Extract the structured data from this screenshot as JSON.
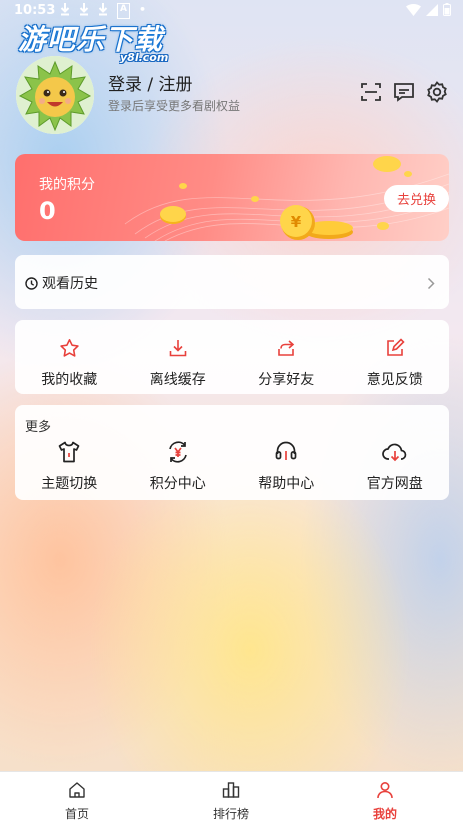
{
  "status_bar": {
    "time": "10:53",
    "left_icons": [
      "download-icon",
      "download-icon",
      "download-icon",
      "A",
      "•"
    ],
    "right_icons": [
      "wifi-icon",
      "signal-icon",
      "battery-icon"
    ]
  },
  "watermark": {
    "text_cn": "游吧乐下载",
    "text_en": "y8l.com"
  },
  "profile": {
    "avatar_icon": "durian-mascot-icon",
    "title": "登录 / 注册",
    "subtitle": "登录后享受更多看剧权益"
  },
  "top_actions": [
    "scan-icon",
    "message-icon",
    "settings-icon"
  ],
  "points": {
    "title": "我的积分",
    "value": "0",
    "redeem_label": "去兑换"
  },
  "history": {
    "label": "观看历史"
  },
  "quick_actions": [
    {
      "label": "我的收藏",
      "icon": "star-icon"
    },
    {
      "label": "离线缓存",
      "icon": "download-icon"
    },
    {
      "label": "分享好友",
      "icon": "share-icon"
    },
    {
      "label": "意见反馈",
      "icon": "feedback-edit-icon"
    }
  ],
  "more": {
    "title": "更多",
    "items": [
      {
        "label": "主题切换",
        "icon": "shirt-icon"
      },
      {
        "label": "积分中心",
        "icon": "points-yen-icon"
      },
      {
        "label": "帮助中心",
        "icon": "headset-icon"
      },
      {
        "label": "官方网盘",
        "icon": "cloud-download-icon"
      }
    ]
  },
  "bottom_nav": [
    {
      "label": "首页",
      "icon": "home-icon",
      "active": false
    },
    {
      "label": "排行榜",
      "icon": "ranking-icon",
      "active": false
    },
    {
      "label": "我的",
      "icon": "user-icon",
      "active": true
    }
  ],
  "colors": {
    "accent": "#e8413c",
    "text": "#222222",
    "points_card_start": "#ff6f6d",
    "points_card_end": "#ffcfc7"
  }
}
